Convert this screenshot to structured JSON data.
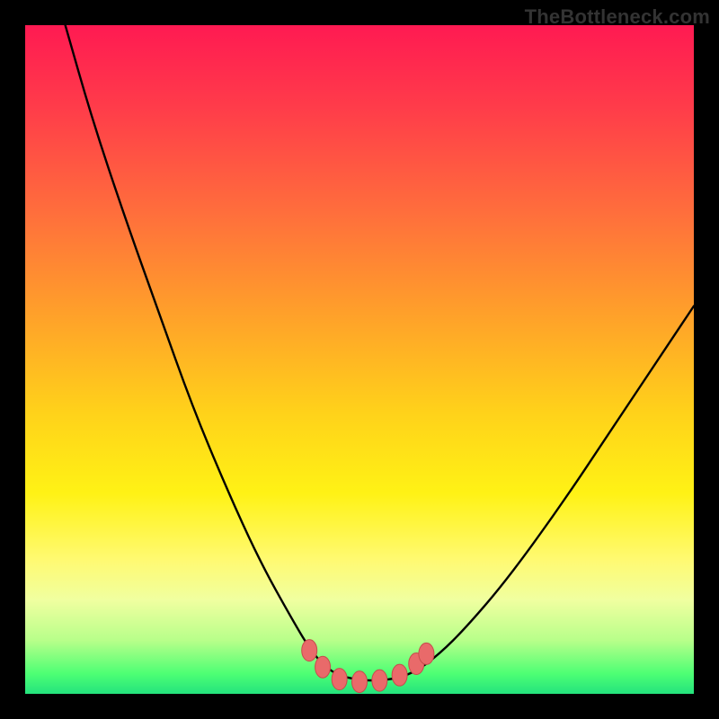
{
  "watermark": "TheBottleneck.com",
  "chart_data": {
    "type": "line",
    "title": "",
    "xlabel": "",
    "ylabel": "",
    "xlim": [
      0,
      1
    ],
    "ylim": [
      0,
      1
    ],
    "series": [
      {
        "name": "curve",
        "x": [
          0.06,
          0.1,
          0.15,
          0.2,
          0.25,
          0.3,
          0.35,
          0.4,
          0.43,
          0.46,
          0.5,
          0.54,
          0.58,
          0.62,
          0.66,
          0.72,
          0.8,
          0.88,
          0.96,
          1.0
        ],
        "y": [
          1.0,
          0.86,
          0.71,
          0.57,
          0.43,
          0.31,
          0.2,
          0.11,
          0.06,
          0.03,
          0.02,
          0.02,
          0.03,
          0.06,
          0.1,
          0.17,
          0.28,
          0.4,
          0.52,
          0.58
        ]
      }
    ],
    "valley_markers": {
      "x": [
        0.425,
        0.445,
        0.47,
        0.5,
        0.53,
        0.56,
        0.585,
        0.6
      ],
      "y": [
        0.065,
        0.04,
        0.022,
        0.018,
        0.02,
        0.028,
        0.045,
        0.06
      ]
    },
    "colors": {
      "curve": "#000000",
      "markers_fill": "#e96a6a",
      "markers_stroke": "#c64c4c"
    }
  }
}
